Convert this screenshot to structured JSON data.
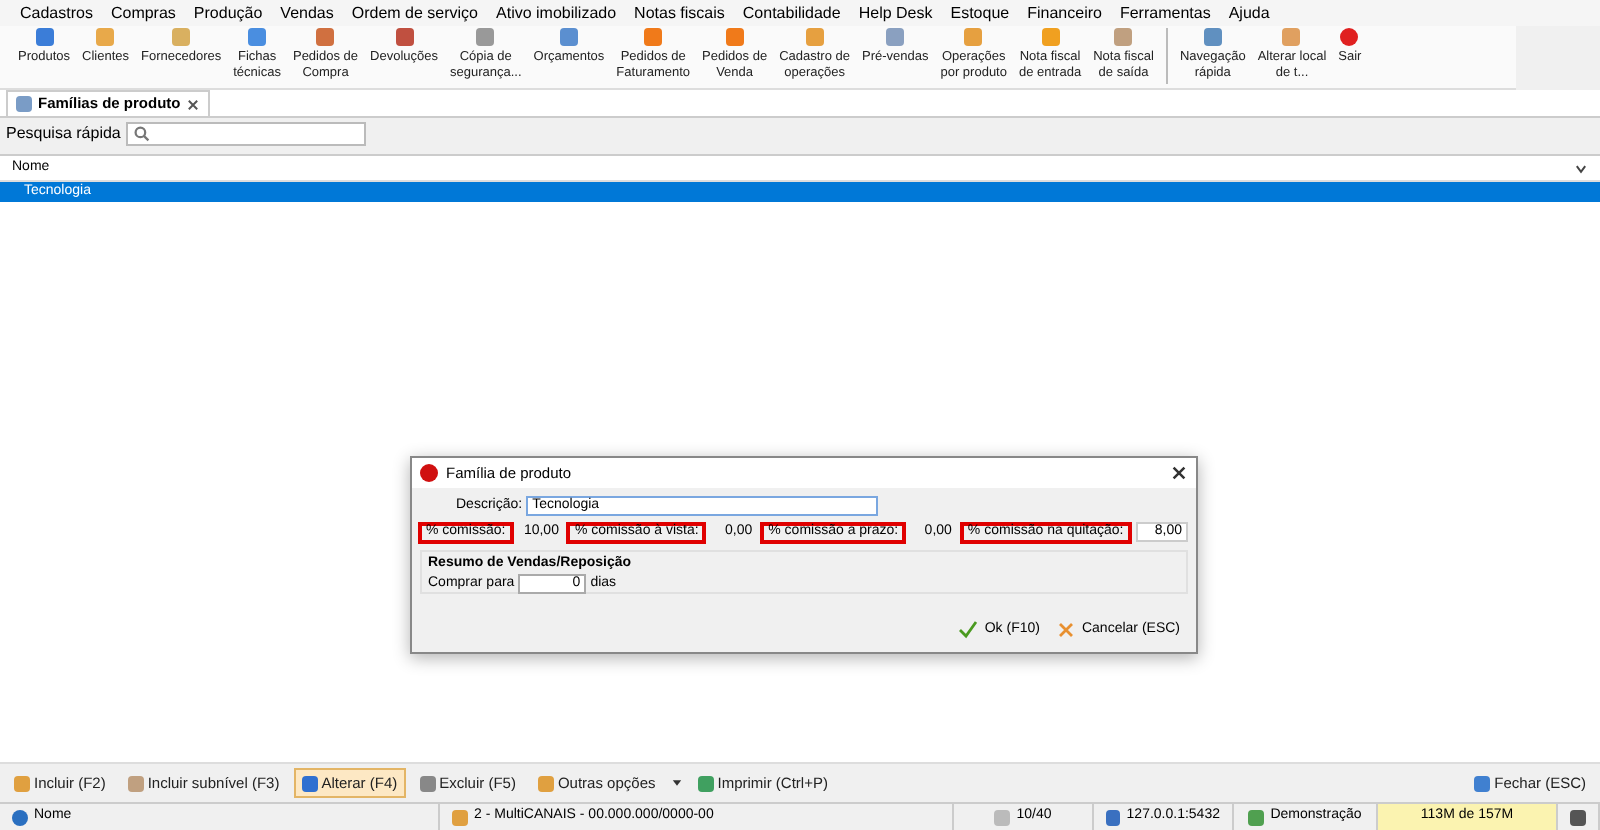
{
  "menu": [
    "Cadastros",
    "Compras",
    "Produção",
    "Vendas",
    "Ordem de serviço",
    "Ativo imobilizado",
    "Notas fiscais",
    "Contabilidade",
    "Help Desk",
    "Estoque",
    "Financeiro",
    "Ferramentas",
    "Ajuda"
  ],
  "toolbar": [
    {
      "label": "Produtos"
    },
    {
      "label": "Clientes"
    },
    {
      "label": "Fornecedores"
    },
    {
      "label": "Fichas\ntécnicas"
    },
    {
      "label": "Pedidos de\nCompra"
    },
    {
      "label": "Devoluções"
    },
    {
      "label": "Cópia de\nsegurança..."
    },
    {
      "label": "Orçamentos"
    },
    {
      "label": "Pedidos de\nFaturamento"
    },
    {
      "label": "Pedidos de\nVenda"
    },
    {
      "label": "Cadastro de\noperações"
    },
    {
      "label": "Pré-vendas"
    },
    {
      "label": "Operações\npor produto"
    },
    {
      "label": "Nota fiscal\nde entrada"
    },
    {
      "label": "Nota fiscal\nde saída"
    },
    {
      "label": "Navegação\nrápida",
      "separator_before": true
    },
    {
      "label": "Alterar local\nde t..."
    },
    {
      "label": "Sair"
    }
  ],
  "tab": {
    "label": "Famílias de produto",
    "selected": true
  },
  "search": {
    "label": "Pesquisa rápida"
  },
  "grid": {
    "columns": [
      "Nome"
    ],
    "rows": [
      {
        "nome": "Tecnologia",
        "selected": true
      }
    ]
  },
  "dialog": {
    "title": "Família de produto",
    "descricao_label": "Descrição:",
    "descricao_value": "Tecnologia",
    "fields": [
      {
        "label": "% comissão:",
        "value": "10,00",
        "highlighted": true
      },
      {
        "label": "% comissão à vista:",
        "value": "0,00",
        "highlighted": true
      },
      {
        "label": "% comissão a prazo:",
        "value": "0,00",
        "highlighted": true
      },
      {
        "label": "% comissão na quitação:",
        "value": "8,00",
        "highlighted": true
      }
    ],
    "group_title": "Resumo de Vendas/Reposição",
    "comprar_label": "Comprar para",
    "comprar_value": "0",
    "dias_label": "dias",
    "buttons": [
      "Ok (F10)",
      "Cancelar (ESC)"
    ]
  },
  "actions": [
    {
      "label": "Incluir (F2)",
      "selected": false
    },
    {
      "label": "Incluir subnível (F3)",
      "selected": false
    },
    {
      "label": "Alterar (F4)",
      "selected": true
    },
    {
      "label": "Excluir (F5)",
      "selected": false
    },
    {
      "label": "Outras opções",
      "selected": false
    },
    {
      "label": "Imprimir (Ctrl+P)",
      "selected": false
    }
  ],
  "close_action": "Fechar (ESC)",
  "status_bar": [
    "Nome",
    "2 - MultiCANAIS - 00.000.000/0000-00",
    "10/40",
    "127.0.0.1:5432",
    "Demonstração",
    "113M de 157M"
  ]
}
